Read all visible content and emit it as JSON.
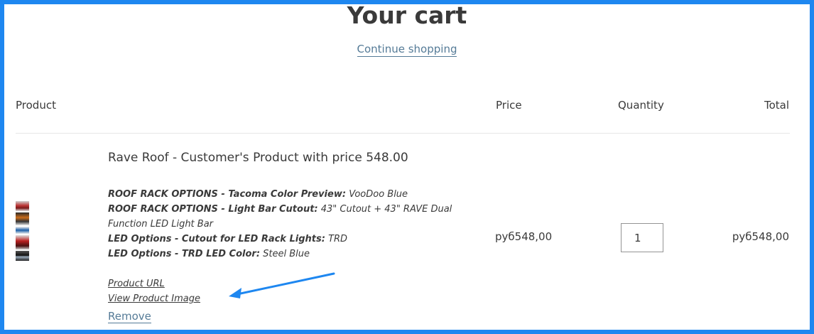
{
  "header": {
    "title": "Your cart",
    "continue_label": "Continue shopping"
  },
  "table": {
    "columns": [
      "Product",
      "Price",
      "Quantity",
      "Total"
    ]
  },
  "item": {
    "name": "Rave Roof - Customer's Product with price 548.00",
    "options": [
      {
        "name": "ROOF RACK OPTIONS - Tacoma Color Preview:",
        "value": "VooDoo Blue"
      },
      {
        "name": "ROOF RACK OPTIONS - Light Bar Cutout:",
        "value": "43\" Cutout + 43\" RAVE Dual Function LED Light Bar"
      },
      {
        "name": "LED Options - Cutout for LED Rack Lights:",
        "value": "TRD"
      },
      {
        "name": "LED Options - TRD LED Color:",
        "value": "Steel Blue"
      }
    ],
    "links": {
      "product_url": "Product URL",
      "view_image": "View Product Image"
    },
    "remove_label": "Remove",
    "price": "руб548,00",
    "quantity": "1",
    "total": "руб548,00"
  },
  "annotation": {
    "arrow_color": "#1e87f0"
  }
}
